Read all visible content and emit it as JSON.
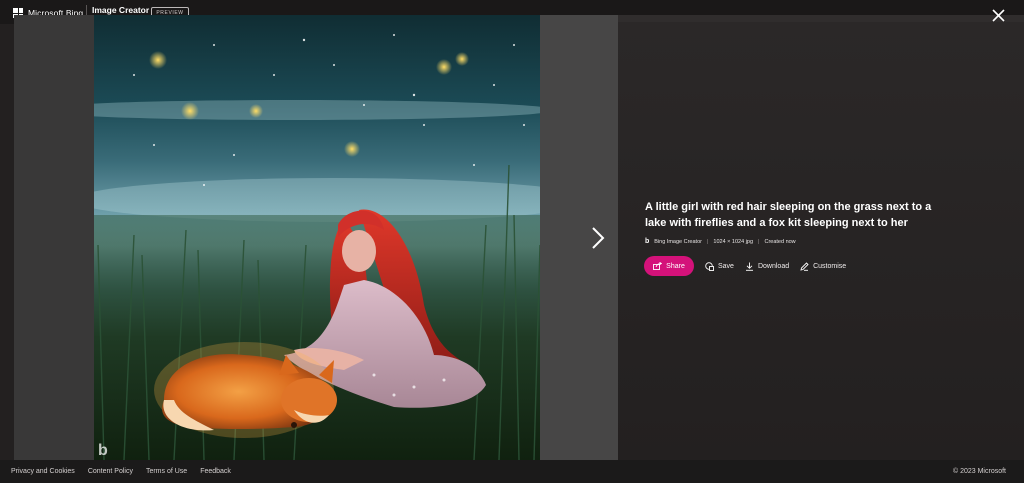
{
  "header": {
    "brand": "Microsoft Bing",
    "product": "Image Creator",
    "badge": "PREVIEW"
  },
  "image": {
    "alt": "A little girl with red hair sleeping on the grass next to a lake with fireflies and a fox kit sleeping next to her",
    "watermark": "b"
  },
  "details": {
    "title": "A little girl with red hair sleeping on the grass next to a lake with fireflies and a fox kit sleeping next to her",
    "source": "Bing Image Creator",
    "dimensions": "1024 × 1024 jpg",
    "created": "Created now",
    "separator": "|"
  },
  "actions": {
    "share": "Share",
    "save": "Save",
    "download": "Download",
    "customise": "Customise"
  },
  "footer": {
    "links": [
      "Privacy and Cookies",
      "Content Policy",
      "Terms of Use",
      "Feedback"
    ],
    "copyright": "© 2023 Microsoft"
  },
  "icons": {
    "close": "close-icon",
    "next": "chevron-right-icon",
    "share": "share-icon",
    "save": "save-icon",
    "download": "download-icon",
    "customise": "customise-icon"
  },
  "colors": {
    "accent": "#d4127a",
    "background": "#232020"
  }
}
